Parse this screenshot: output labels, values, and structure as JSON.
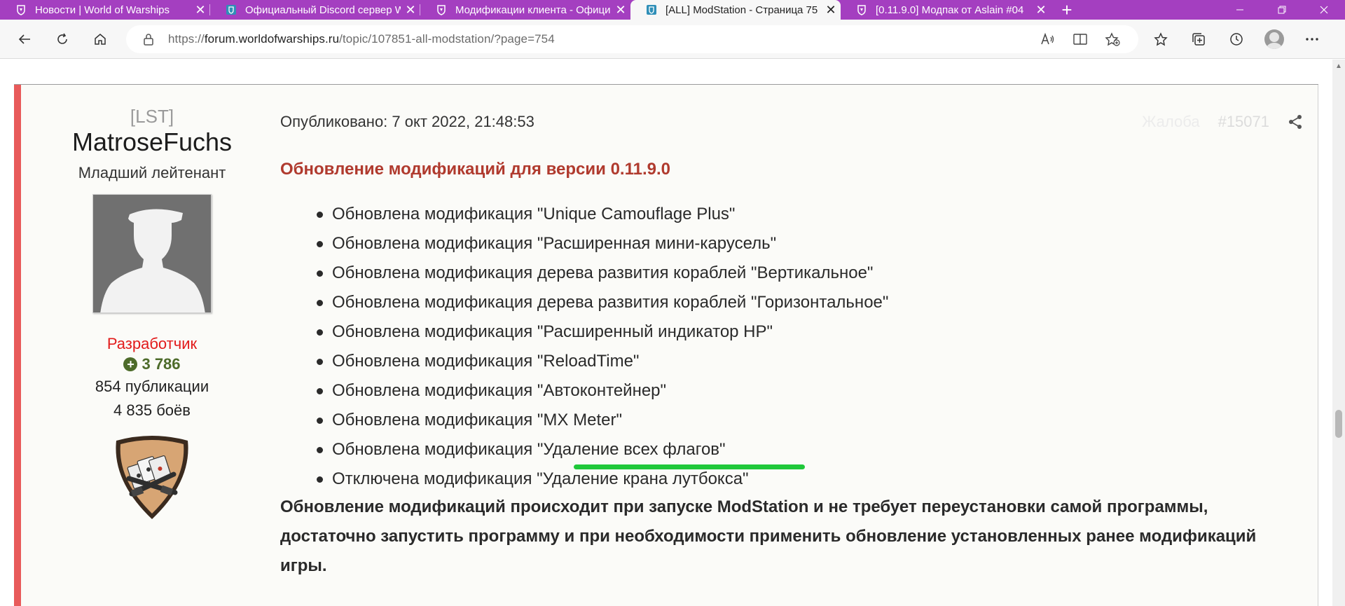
{
  "browser": {
    "tabs": [
      {
        "title": "Новости | World of Warships",
        "active": false,
        "icon": "warships-icon"
      },
      {
        "title": "Официальный Discord сервер W",
        "active": false,
        "icon": "shield-icon"
      },
      {
        "title": "Модификации клиента - Официа",
        "active": false,
        "icon": "warships-icon"
      },
      {
        "title": "[ALL] ModStation - Страница 75",
        "active": true,
        "icon": "shield-icon"
      },
      {
        "title": "[0.11.9.0] Модпак от Aslain #04",
        "active": false,
        "icon": "warships-icon"
      }
    ],
    "address": {
      "prefix": "https://",
      "host": "forum.worldofwarships.ru",
      "path": "/topic/107851-all-modstation/?page=754"
    }
  },
  "post": {
    "author": {
      "clan": "[LST]",
      "name": "MatroseFuchs",
      "rank": "Младший лейтенант",
      "role": "Разработчик",
      "reputation": "3 786",
      "posts": "854 публикации",
      "battles": "4 835 боёв"
    },
    "published": "Опубликовано: 7 окт 2022, 21:48:53",
    "report_label": "Жалоба",
    "post_number": "#15071",
    "heading": "Обновление модификаций для версии 0.11.9.0",
    "changes": [
      "Обновлена модификация \"Unique Camouflage Plus\"",
      "Обновлена модификация \"Расширенная мини-карусель\"",
      "Обновлена модификация дерева развития кораблей \"Вертикальное\"",
      "Обновлена модификация дерева развития кораблей \"Горизонтальное\"",
      "Обновлена модификация \"Расширенный индикатор HP\"",
      "Обновлена модификация \"ReloadTime\"",
      "Обновлена модификация \"Автоконтейнер\"",
      "Обновлена модификация \"MX Meter\"",
      "Обновлена модификация \"Удаление всех флагов\"",
      "Отключена модификация \"Удаление крана лутбокса\""
    ],
    "footer": "Обновление модификаций происходит при запуске ModStation и не требует переустановки самой программы, достаточно запустить программу и при необходимости применить обновление установленных ранее модификаций игры."
  },
  "colors": {
    "tab_strip": "#a43fc0",
    "post_accent": "#e85a5a",
    "heading": "#b03a2e",
    "role": "#e21b1b",
    "reputation": "#4d6b2a",
    "highlight_underline": "#1fc83a"
  }
}
